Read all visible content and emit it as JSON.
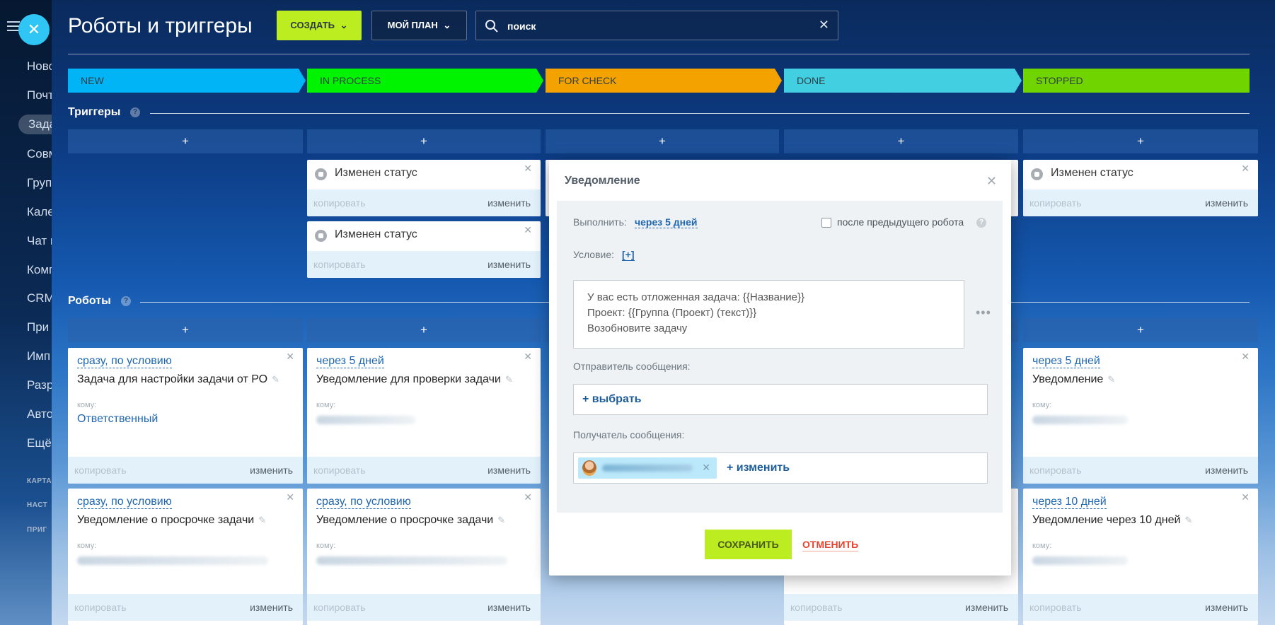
{
  "sidebar": {
    "items": [
      "Ново",
      "Почт",
      "Зада",
      "Совм",
      "Груп",
      "Кале",
      "Чат и",
      "Комп",
      "CRM",
      "При",
      "Имп",
      "Разр",
      "Авто",
      "Ещё"
    ],
    "active_index": 2,
    "small_labels": [
      "КАРТА",
      "НАСТ",
      "ПРИГ"
    ]
  },
  "header": {
    "title": "Роботы и триггеры",
    "create_label": "СОЗДАТЬ",
    "plan_label": "МОЙ ПЛАН",
    "search_value": "поиск"
  },
  "stages": [
    {
      "label": "NEW",
      "color": "#00b4f6"
    },
    {
      "label": "IN PROCESS",
      "color": "#00f400"
    },
    {
      "label": "FOR CHECK",
      "color": "#f4a200"
    },
    {
      "label": "DONE",
      "color": "#43cfe2"
    },
    {
      "label": "STOPPED",
      "color": "#6fd400"
    }
  ],
  "triggers": {
    "title": "Триггеры",
    "add_label": "+",
    "cards": [
      {
        "title": "Изменен статус",
        "copy": "копировать",
        "edit": "изменить"
      },
      {
        "title": "Изменен статус",
        "copy": "копировать",
        "edit": "изменить"
      },
      {
        "title": "Изменен статус",
        "copy": "копировать",
        "edit": "изменить"
      }
    ]
  },
  "robots": {
    "title": "Роботы",
    "add_label": "+",
    "to_label": "кому:",
    "copy": "копировать",
    "edit": "изменить",
    "cards": [
      {
        "delay": "сразу, по условию",
        "title": "Задача для настройки задачи от РО",
        "recipient": "Ответственный"
      },
      {
        "delay": "через 5 дней",
        "title": "Уведомление для проверки задачи"
      },
      {
        "delay": "через 5 дней",
        "title": "Уведомление"
      },
      {
        "delay": "сразу, по условию",
        "title": "Уведомление о просрочке задачи"
      },
      {
        "delay": "сразу, по условию",
        "title": "Уведомление о просрочке задачи"
      },
      {
        "delay": "через 10 дней",
        "title": "Уведомление через 10 дней"
      }
    ]
  },
  "modal": {
    "title": "Уведомление",
    "execute_label": "Выполнить:",
    "execute_value": "через 5 дней",
    "after_prev_label": "после предыдущего робота",
    "condition_label": "Условие:",
    "condition_add": "[+]",
    "message_lines": [
      "У вас есть отложенная задача: {{Название}}",
      "Проект: {{Группа (Проект) (текст)}}",
      "Возобновите задачу"
    ],
    "sender_label": "Отправитель сообщения:",
    "sender_select": "+ выбрать",
    "receiver_label": "Получатель сообщения:",
    "receiver_change": "+ изменить",
    "save_label": "СОХРАНИТЬ",
    "cancel_label": "ОТМЕНИТЬ"
  }
}
